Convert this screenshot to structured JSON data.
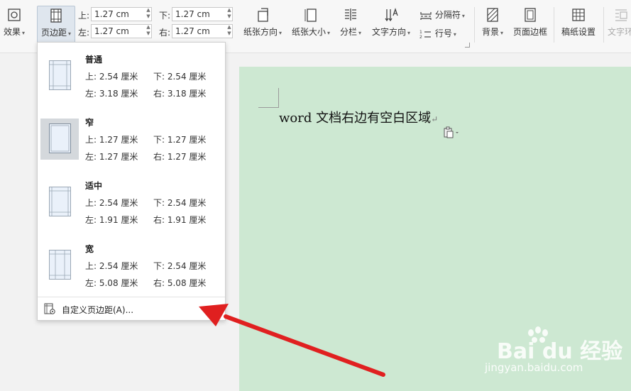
{
  "toolbar": {
    "effects_label": "效果",
    "margins_label": "页边距",
    "top_label": "上:",
    "top_value": "1.27 cm",
    "bottom_label": "下:",
    "bottom_value": "1.27 cm",
    "left_label": "左:",
    "left_value": "1.27 cm",
    "right_label": "右:",
    "right_value": "1.27 cm",
    "orientation_label": "纸张方向",
    "size_label": "纸张大小",
    "columns_label": "分栏",
    "text_direction_label": "文字方向",
    "breaks_label": "分隔符",
    "line_numbers_label": "行号",
    "background_label": "背景",
    "page_border_label": "页面边框",
    "manuscript_label": "稿纸设置",
    "text_label_cut": "文字环"
  },
  "dropdown": {
    "presets": [
      {
        "name": "普通",
        "top": "上: 2.54 厘米",
        "bottom": "下: 2.54 厘米",
        "left": "左: 3.18 厘米",
        "right": "右: 3.18 厘米"
      },
      {
        "name": "窄",
        "top": "上: 1.27 厘米",
        "bottom": "下: 1.27 厘米",
        "left": "左: 1.27 厘米",
        "right": "右: 1.27 厘米"
      },
      {
        "name": "适中",
        "top": "上: 2.54 厘米",
        "bottom": "下: 2.54 厘米",
        "left": "左: 1.91 厘米",
        "right": "右: 1.91 厘米"
      },
      {
        "name": "宽",
        "top": "上: 2.54 厘米",
        "bottom": "下: 2.54 厘米",
        "left": "左: 5.08 厘米",
        "right": "右: 5.08 厘米"
      }
    ],
    "custom_label": "自定义页边距(A)..."
  },
  "document": {
    "text": "word 文档右边有空白区域",
    "para_mark": "↵"
  },
  "watermark": {
    "brand": "Bai du 经验",
    "url": "jingyan.baidu.com"
  },
  "colors": {
    "doc_bg": "#cde8d2",
    "arrow": "#e02020"
  }
}
